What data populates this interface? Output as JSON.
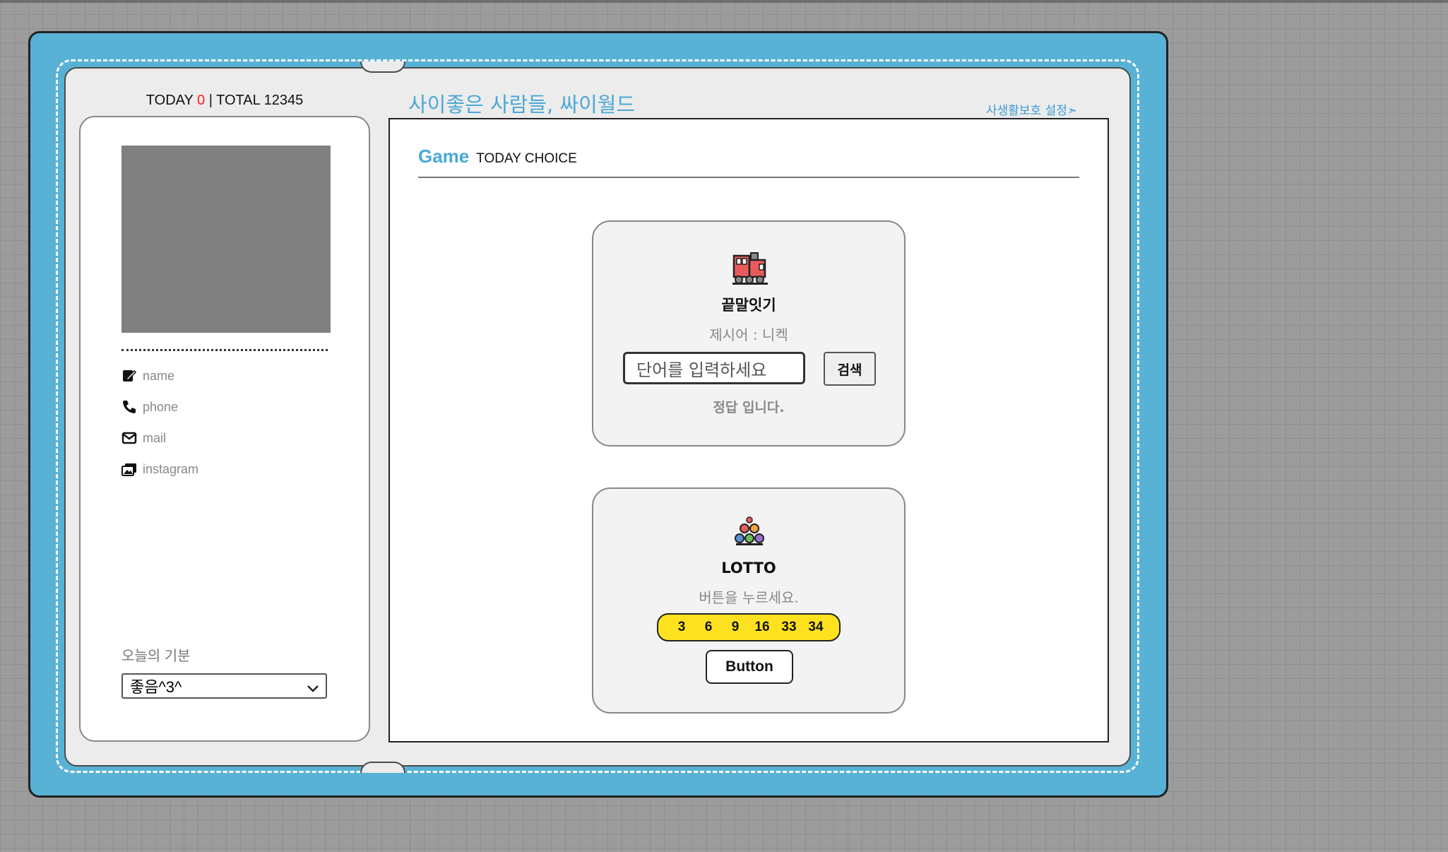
{
  "counter": {
    "today_label": "TODAY",
    "today_value": "0",
    "separator": "|",
    "total_label": "TOTAL",
    "total_value": "12345"
  },
  "site": {
    "title": "사이좋은 사람들, 싸이월드",
    "privacy_link": "사생활보호 설정➣"
  },
  "profile": {
    "items": [
      {
        "icon": "edit-icon",
        "label": "name"
      },
      {
        "icon": "phone-icon",
        "label": "phone"
      },
      {
        "icon": "mail-icon",
        "label": "mail"
      },
      {
        "icon": "image-icon",
        "label": "instagram"
      }
    ],
    "mood_label": "오늘의 기분",
    "mood_selected": "좋음^3^"
  },
  "main": {
    "section_title": "Game",
    "section_subtitle": "TODAY CHOICE"
  },
  "word_game": {
    "icon": "train-icon",
    "title": "끝말잇기",
    "prompt": "제시어 : 니켁",
    "input_placeholder": "단어를 입력하세요",
    "search_label": "검색",
    "result": "정답 입니다."
  },
  "lotto": {
    "icon": "lotto-balls-icon",
    "title": "LOTTO",
    "instruction": "버튼을 누르세요.",
    "numbers": [
      "3",
      "6",
      "9",
      "16",
      "33",
      "34"
    ],
    "button_label": "Button"
  },
  "colors": {
    "accent": "#4aa8d6",
    "frame": "#58b2d6",
    "lotto_bar": "#ffe21f",
    "today_count": "#ff1a1a"
  }
}
